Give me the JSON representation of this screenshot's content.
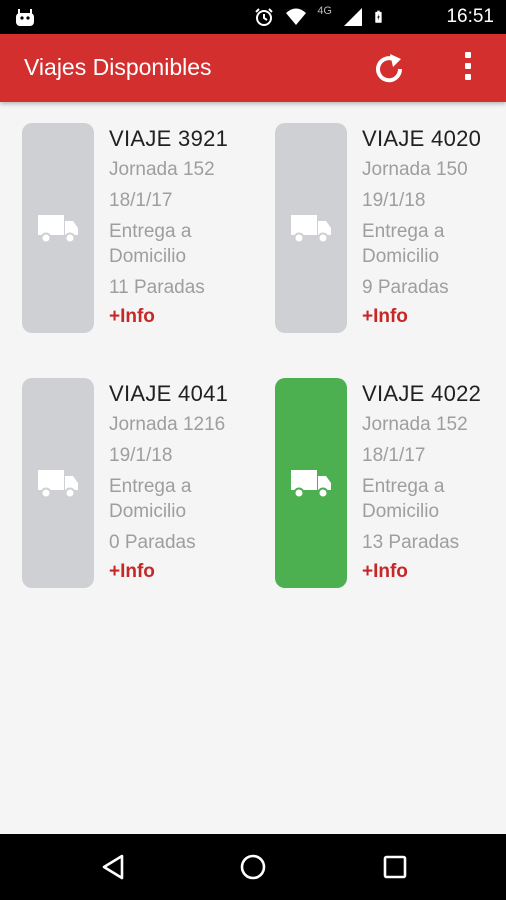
{
  "status_bar": {
    "time": "16:51",
    "network_label": "4G",
    "icons": [
      "android-icon",
      "alarm-icon",
      "wifi-icon",
      "signal-icon",
      "battery-icon"
    ]
  },
  "app_bar": {
    "title": "Viajes Disponibles",
    "actions": [
      "refresh-icon",
      "overflow-menu-icon"
    ],
    "color": "#d32f2f"
  },
  "trips": [
    {
      "title": "VIAJE 3921",
      "jornada": "Jornada 152",
      "date": "18/1/17",
      "delivery_line1": "Entrega a",
      "delivery_line2": "Domicilio",
      "stops": "11 Paradas",
      "more": "+Info",
      "status_color": "#cfd0d3"
    },
    {
      "title": "VIAJE 4020",
      "jornada": "Jornada 150",
      "date": "19/1/18",
      "delivery_line1": "Entrega a",
      "delivery_line2": "Domicilio",
      "stops": "9 Paradas",
      "more": "+Info",
      "status_color": "#cfd0d3"
    },
    {
      "title": "VIAJE 4041",
      "jornada": "Jornada 1216",
      "date": "19/1/18",
      "delivery_line1": "Entrega a",
      "delivery_line2": "Domicilio",
      "stops": "0 Paradas",
      "more": "+Info",
      "status_color": "#cfd0d3"
    },
    {
      "title": "VIAJE 4022",
      "jornada": "Jornada 152",
      "date": "18/1/17",
      "delivery_line1": "Entrega a",
      "delivery_line2": "Domicilio",
      "stops": "13 Paradas",
      "more": "+Info",
      "status_color": "#4caf50"
    }
  ],
  "nav_bar": {
    "buttons": [
      "back-icon",
      "home-icon",
      "recents-icon"
    ]
  }
}
